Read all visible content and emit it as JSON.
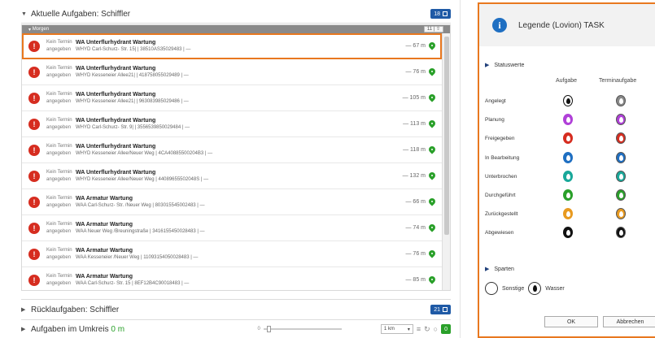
{
  "task_panel": {
    "current_section": {
      "title": "Aktuelle Aufgaben: Schiffler",
      "badge_count": "18"
    },
    "group": {
      "label": "Morgen",
      "count": "11"
    },
    "rows": [
      {
        "meta_line1": "Kein Termin",
        "meta_line2": "angegeben",
        "title": "WA Unterflurhydrant Wartung",
        "subtitle": "WHYD Carl-Schurz- Str. 15| | 38510AS35029483 | —",
        "distance": "— 67 m",
        "selected": true
      },
      {
        "meta_line1": "Kein Termin",
        "meta_line2": "angegeben",
        "title": "WA Unterflurhydrant Wartung",
        "subtitle": "WHYD Kesseneier Allee21| | 418758055029489 | —",
        "distance": "— 76 m",
        "selected": false
      },
      {
        "meta_line1": "Kein Termin",
        "meta_line2": "angegeben",
        "title": "WA Unterflurhydrant Wartung",
        "subtitle": "WHYD Kesseneier Allee21| | 963083985029486 | —",
        "distance": "— 105 m",
        "selected": false
      },
      {
        "meta_line1": "Kein Termin",
        "meta_line2": "angegeben",
        "title": "WA Unterflurhydrant Wartung",
        "subtitle": "WHYD Carl-Schurz- Str. 9| | 3556539850029484 | —",
        "distance": "— 113 m",
        "selected": false
      },
      {
        "meta_line1": "Kein Termin",
        "meta_line2": "angegeben",
        "title": "WA Unterflurhydrant Wartung",
        "subtitle": "WHYD Kesseneier Allee/Neuer Weg | 4CA40885500204B3 | —",
        "distance": "— 118 m",
        "selected": false
      },
      {
        "meta_line1": "Kein Termin",
        "meta_line2": "angegeben",
        "title": "WA Unterflurhydrant Wartung",
        "subtitle": "WHYD Kesseneier Allee/Neuer Weg | 44089655502048S | —",
        "distance": "— 132 m",
        "selected": false
      },
      {
        "meta_line1": "Kein Termin",
        "meta_line2": "angegeben",
        "title": "WA Armatur Wartung",
        "subtitle": "WAA Carl-Schurz- Str. /Neuer Weg | 803015545002483 | —",
        "distance": "— 66 m",
        "selected": false
      },
      {
        "meta_line1": "Kein Termin",
        "meta_line2": "angegeben",
        "title": "WA Armatur Wartung",
        "subtitle": "WAA Neuer Weg /Breuningstraße | 3416155450028483 | —",
        "distance": "— 74 m",
        "selected": false
      },
      {
        "meta_line1": "Kein Termin",
        "meta_line2": "angegeben",
        "title": "WA Armatur Wartung",
        "subtitle": "WAA Kesseneier /Neuer Weg | 11093154050028483 | —",
        "distance": "— 76 m",
        "selected": false
      },
      {
        "meta_line1": "Kein Termin",
        "meta_line2": "angegeben",
        "title": "WA Armatur Wartung",
        "subtitle": "WAA Carl-Schurz- Str. 15 | 8EF12B4C90018483 | —",
        "distance": "— 85 m",
        "selected": false
      }
    ],
    "return_section": {
      "title": "Rücklaufgaben: Schiffler",
      "badge_count": "21"
    },
    "radius_section": {
      "title_prefix": "Aufgaben im Umkreis",
      "title_value": "0 m",
      "slider_value_label": "0",
      "range_select": "1 km",
      "green_badge": "0"
    }
  },
  "legend": {
    "title": "Legende (Lovion) TASK",
    "status_header": "Statuswerte",
    "col_task": "Aufgabe",
    "col_appointment": "Terminaufgabe",
    "statuses": [
      {
        "label": "Angelegt",
        "color": "#ffffff"
      },
      {
        "label": "Planung",
        "color": "#b040d8"
      },
      {
        "label": "Freigegeben",
        "color": "#d62d20"
      },
      {
        "label": "In Bearbeitung",
        "color": "#1f6fc2"
      },
      {
        "label": "Unterbrochen",
        "color": "#19a89a"
      },
      {
        "label": "Durchgeführt",
        "color": "#2aa02a"
      },
      {
        "label": "Zurückgestellt",
        "color": "#e89a20"
      },
      {
        "label": "Abgewiesen",
        "color": "#111111"
      }
    ],
    "sparten_header": "Sparten",
    "sparten": [
      {
        "label": "Sonstige"
      },
      {
        "label": "Wasser"
      }
    ],
    "ok_label": "OK",
    "cancel_label": "Abbrechen"
  },
  "colors": {
    "accent_orange": "#e8781f",
    "badge_blue": "#1f5aa6",
    "badge_green": "#2aa02a",
    "status_red": "#d62d20"
  }
}
